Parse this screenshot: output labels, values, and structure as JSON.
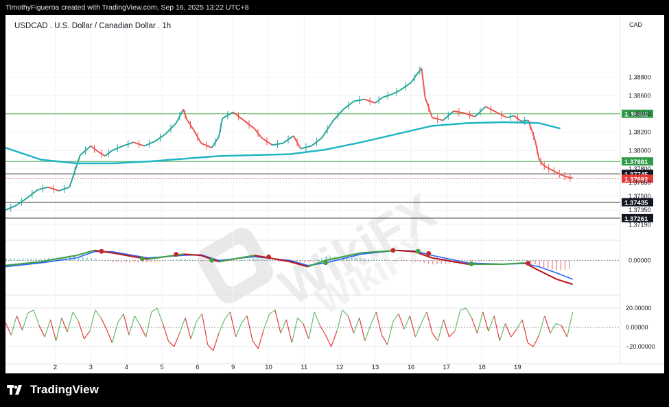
{
  "header": {
    "credit": "TimothyFigueroa created with TradingView.com, Sep 16, 2025 13:22 UTC+8"
  },
  "footer": {
    "brand": "TradingView"
  },
  "watermark": "WikiFX",
  "chart_data": {
    "type": "line",
    "title": "USDCAD . U.S. Dollar / Canadian Dollar . 1h",
    "currency": "CAD",
    "x_ticks": [
      "2",
      "3",
      "4",
      "5",
      "6",
      "9",
      "10",
      "11",
      "12",
      "13",
      "16",
      "17",
      "18",
      "19"
    ],
    "price_axis": {
      "ylim": [
        1.3708,
        1.3918
      ],
      "ticks": [
        "1.38800",
        "1.38600",
        "1.38400",
        "1.38200",
        "1.38000",
        "1.37800",
        "1.37650",
        "1.37500",
        "1.37350",
        "1.37190"
      ]
    },
    "close_series": {
      "name": "USDCAD 1h close (approx.)",
      "x": [
        0,
        0.3,
        0.6,
        0.9,
        1.2,
        1.5,
        1.8,
        2.1,
        2.4,
        2.6,
        2.8,
        3.0,
        3.3,
        3.6,
        3.9,
        4.2,
        4.5,
        4.8,
        5.0,
        5.1,
        5.3,
        5.5,
        5.8,
        6.0,
        6.1,
        6.4,
        6.7,
        7.0,
        7.2,
        7.5,
        7.8,
        8.1,
        8.3,
        8.6,
        8.9,
        9.2,
        9.5,
        9.8,
        10.1,
        10.4,
        10.6,
        10.9,
        11.1,
        11.4,
        11.6,
        11.7,
        11.8,
        12.0,
        12.3,
        12.6,
        12.9,
        13.2,
        13.5,
        13.8,
        14.1,
        14.3,
        14.5,
        14.7,
        14.8,
        14.9,
        15.0,
        15.1,
        15.2,
        15.35,
        15.5,
        15.65,
        15.8,
        15.95
      ],
      "y": [
        1.3735,
        1.374,
        1.3748,
        1.3757,
        1.376,
        1.3756,
        1.376,
        1.3795,
        1.3805,
        1.3799,
        1.3794,
        1.38,
        1.3805,
        1.3809,
        1.3805,
        1.381,
        1.3818,
        1.383,
        1.3845,
        1.3834,
        1.3822,
        1.3808,
        1.3803,
        1.3815,
        1.3835,
        1.3842,
        1.3833,
        1.3824,
        1.3814,
        1.3806,
        1.3808,
        1.3816,
        1.3802,
        1.3805,
        1.3814,
        1.3832,
        1.3845,
        1.3854,
        1.3856,
        1.3852,
        1.3858,
        1.3862,
        1.3866,
        1.3874,
        1.3885,
        1.389,
        1.3858,
        1.3836,
        1.3833,
        1.3843,
        1.3841,
        1.3837,
        1.3848,
        1.3842,
        1.3836,
        1.3838,
        1.3832,
        1.3833,
        1.3822,
        1.381,
        1.3791,
        1.3785,
        1.3782,
        1.3779,
        1.3776,
        1.3773,
        1.3771,
        1.377
      ]
    },
    "moving_average": {
      "name": "Moving average (approx.)",
      "x": [
        0,
        1,
        2,
        3,
        4,
        5,
        6,
        7,
        8,
        9,
        10,
        11,
        12,
        13,
        14,
        15,
        15.6
      ],
      "y": [
        1.3803,
        1.379,
        1.3786,
        1.3786,
        1.3788,
        1.3791,
        1.3794,
        1.3795,
        1.3796,
        1.3801,
        1.3809,
        1.3818,
        1.3827,
        1.383,
        1.3831,
        1.383,
        1.3824
      ]
    },
    "horizontal_levels": [
      {
        "label": "1.38402",
        "value": 1.38402,
        "color": "#2e9b47",
        "line": "#4caf50"
      },
      {
        "label": "1.37881",
        "value": 1.37881,
        "color": "#2e9b47",
        "line": "#4caf50"
      },
      {
        "label": "1.37745",
        "value": 1.37745,
        "color": "#131722",
        "line": "#222222"
      },
      {
        "label": "1.37692",
        "value": 1.37692,
        "color": "#e53935",
        "line": "#e57373"
      },
      {
        "label": "1.37435",
        "value": 1.37435,
        "color": "#131722",
        "line": "#222222"
      },
      {
        "label": "1.37261",
        "value": 1.37261,
        "color": "#131722",
        "line": "#222222"
      }
    ],
    "macd": {
      "zero_label": "0.00000",
      "macd_line": {
        "x": [
          0,
          1,
          2,
          2.5,
          3,
          4,
          5,
          5.5,
          6,
          7,
          8,
          8.5,
          9,
          10,
          11,
          11.5,
          12,
          13,
          14,
          14.6,
          15,
          15.5,
          15.95
        ],
        "y": [
          -0.4,
          -0.1,
          0.4,
          0.8,
          0.6,
          0.1,
          0.5,
          0.4,
          -0.1,
          0.4,
          -0.1,
          -0.5,
          0.0,
          0.6,
          0.8,
          0.7,
          0.2,
          -0.3,
          -0.3,
          -0.2,
          -0.8,
          -1.5,
          -1.9
        ]
      },
      "signal_line": {
        "x": [
          0,
          1,
          2,
          2.5,
          3,
          4,
          5,
          5.5,
          6,
          7,
          8,
          8.5,
          9,
          10,
          11,
          11.5,
          12,
          13,
          14,
          14.6,
          15,
          15.5,
          15.95
        ],
        "y": [
          -0.5,
          -0.2,
          0.2,
          0.7,
          0.7,
          0.2,
          0.4,
          0.45,
          0.0,
          0.3,
          0.0,
          -0.4,
          -0.2,
          0.5,
          0.8,
          0.75,
          0.4,
          -0.2,
          -0.3,
          -0.25,
          -0.5,
          -1.0,
          -1.5
        ]
      },
      "cross_dots": [
        {
          "x": 2.7,
          "y": 0.72,
          "color": "#c62828"
        },
        {
          "x": 3.85,
          "y": 0.15,
          "color": "#43a047"
        },
        {
          "x": 4.8,
          "y": 0.48,
          "color": "#c62828"
        },
        {
          "x": 5.8,
          "y": 0.02,
          "color": "#43a047"
        },
        {
          "x": 7.4,
          "y": 0.28,
          "color": "#c62828"
        },
        {
          "x": 9.0,
          "y": -0.18,
          "color": "#43a047"
        },
        {
          "x": 10.9,
          "y": 0.8,
          "color": "#c62828"
        },
        {
          "x": 11.6,
          "y": 0.72,
          "color": "#43a047"
        },
        {
          "x": 11.9,
          "y": 0.55,
          "color": "#c62828"
        },
        {
          "x": 13.1,
          "y": -0.28,
          "color": "#43a047"
        },
        {
          "x": 14.7,
          "y": -0.22,
          "color": "#c62828"
        }
      ]
    },
    "oscillator": {
      "ticks": [
        "20.00000",
        "0.00000",
        "−20.00000"
      ],
      "values": [
        5,
        -8,
        12,
        -3,
        15,
        18,
        2,
        -10,
        8,
        -14,
        10,
        -5,
        16,
        6,
        -12,
        -4,
        18,
        10,
        -2,
        -16,
        5,
        14,
        -8,
        12,
        2,
        -10,
        16,
        20,
        4,
        -14,
        -20,
        -6,
        10,
        -12,
        6,
        14,
        -18,
        -24,
        -6,
        8,
        16,
        -10,
        4,
        12,
        -14,
        -22,
        -2,
        14,
        18,
        -6,
        8,
        -16,
        10,
        4,
        -12,
        16,
        2,
        -8,
        -20,
        -4,
        18,
        12,
        -6,
        10,
        -14,
        2,
        16,
        -8,
        -18,
        6,
        14,
        -2,
        12,
        -10,
        4,
        16,
        -6,
        -14,
        8,
        -10,
        -4,
        18,
        20,
        10,
        -6,
        16,
        -4,
        12,
        -14,
        4,
        -10,
        -2,
        8,
        -16,
        -20,
        -8,
        12,
        -6,
        4,
        2,
        -10,
        16
      ]
    }
  }
}
